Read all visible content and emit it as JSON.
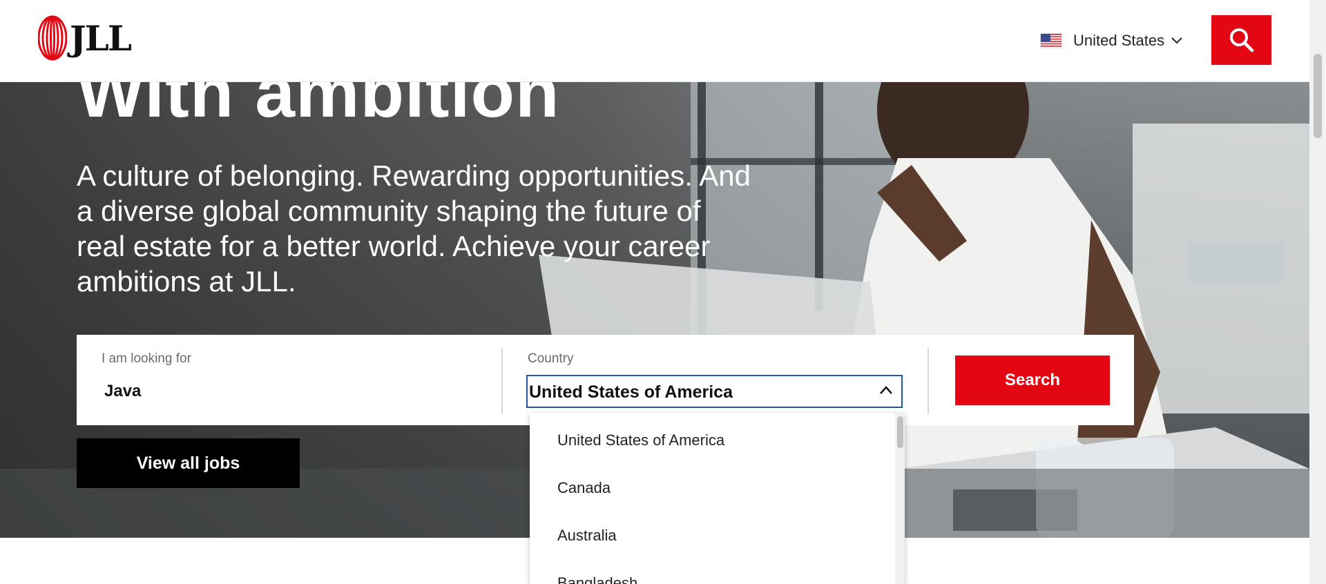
{
  "header": {
    "logo_text": "JLL",
    "country_label": "United States",
    "brand_red": "#e30613"
  },
  "hero": {
    "title": "With ambition",
    "description": "A culture of belonging. Rewarding opportunities. And a diverse global community shaping the future of real estate for a better world. Achieve your career ambitions at JLL."
  },
  "search": {
    "keyword_label": "I am looking for",
    "keyword_value": "Java",
    "country_label": "Country",
    "country_value": "United States of America",
    "search_button": "Search"
  },
  "view_all_button": "View all jobs",
  "dropdown": {
    "options": [
      "United States of America",
      "Canada",
      "Australia",
      "Bangladesh"
    ]
  }
}
